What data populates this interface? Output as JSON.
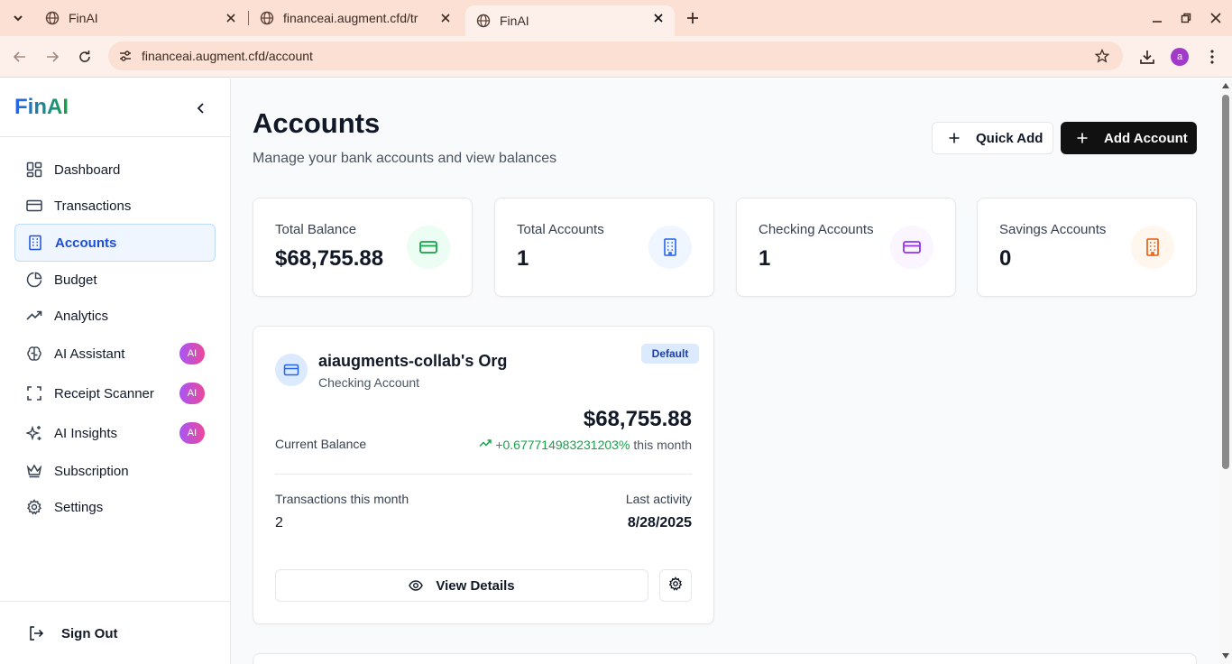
{
  "browser": {
    "tabs": [
      {
        "title": "FinAI",
        "active": false
      },
      {
        "title": "financeai.augment.cfd/tr",
        "active": false
      },
      {
        "title": "FinAI",
        "active": true
      }
    ],
    "url": "financeai.augment.cfd/account",
    "profile_initial": "a"
  },
  "sidebar": {
    "brand": "FinAI",
    "items": [
      {
        "label": "Dashboard",
        "icon": "dashboard-icon"
      },
      {
        "label": "Transactions",
        "icon": "credit-card-icon"
      },
      {
        "label": "Accounts",
        "icon": "building-icon",
        "active": true
      },
      {
        "label": "Budget",
        "icon": "pie-chart-icon"
      },
      {
        "label": "Analytics",
        "icon": "trending-up-icon"
      },
      {
        "label": "AI Assistant",
        "icon": "brain-icon",
        "badge": "AI"
      },
      {
        "label": "Receipt Scanner",
        "icon": "scan-icon",
        "badge": "AI"
      },
      {
        "label": "AI Insights",
        "icon": "sparkles-icon",
        "badge": "AI"
      },
      {
        "label": "Subscription",
        "icon": "crown-icon"
      },
      {
        "label": "Settings",
        "icon": "gear-icon"
      }
    ],
    "sign_out": "Sign Out"
  },
  "header": {
    "title": "Accounts",
    "subtitle": "Manage your bank accounts and view balances",
    "quick_add": "Quick Add",
    "add_account": "Add Account"
  },
  "stats": [
    {
      "label": "Total Balance",
      "value": "$68,755.88",
      "icon": "credit-card-icon",
      "color": "#16a34a"
    },
    {
      "label": "Total Accounts",
      "value": "1",
      "icon": "building-icon",
      "color": "#2563eb"
    },
    {
      "label": "Checking Accounts",
      "value": "1",
      "icon": "credit-card-icon",
      "color": "#9333ea"
    },
    {
      "label": "Savings Accounts",
      "value": "0",
      "icon": "building-icon",
      "color": "#ea580c"
    }
  ],
  "account": {
    "name": "aiaugments-collab's Org",
    "type": "Checking Account",
    "badge": "Default",
    "balance": "$68,755.88",
    "balance_label": "Current Balance",
    "change_pct": "+0.677714983231203%",
    "change_suffix": "this month",
    "tx_label": "Transactions this month",
    "tx_value": "2",
    "last_activity_label": "Last activity",
    "last_activity_value": "8/28/2025",
    "view_details": "View Details"
  },
  "colors": {
    "accent": "#1d4ed8",
    "positive": "#16a34a",
    "ai_badge": "#a855f7",
    "chrome": "#fbe0d3"
  }
}
